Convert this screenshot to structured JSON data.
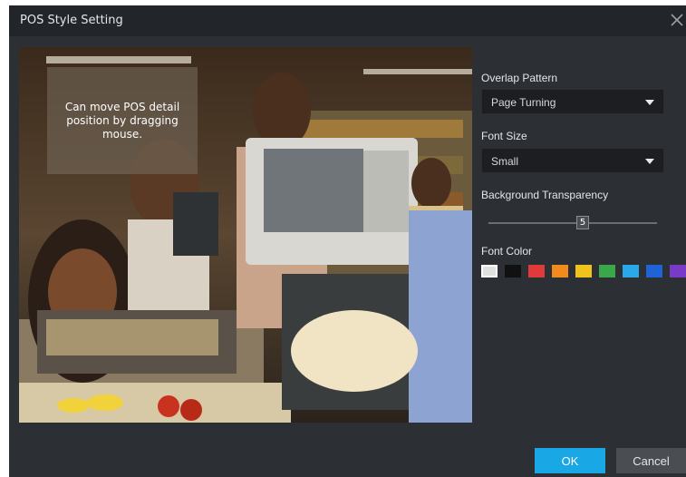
{
  "dialog": {
    "title": "POS Style Setting",
    "close_icon": "close-icon"
  },
  "preview": {
    "overlay_text": "Can move POS detail\nposition by dragging\nmouse."
  },
  "settings": {
    "overlap_pattern": {
      "label": "Overlap Pattern",
      "value": "Page Turning"
    },
    "font_size": {
      "label": "Font Size",
      "value": "Small"
    },
    "background_transparency": {
      "label": "Background Transparency",
      "value": "5"
    },
    "font_color": {
      "label": "Font Color",
      "swatches": [
        {
          "name": "white",
          "color": "#e0e0e0",
          "selected": true
        },
        {
          "name": "black",
          "color": "#111111"
        },
        {
          "name": "red",
          "color": "#e03a3a"
        },
        {
          "name": "orange",
          "color": "#f28a1c"
        },
        {
          "name": "yellow",
          "color": "#f2c21c"
        },
        {
          "name": "green",
          "color": "#3aa84a"
        },
        {
          "name": "light-blue",
          "color": "#2aa9e8"
        },
        {
          "name": "blue",
          "color": "#1f64d6"
        },
        {
          "name": "purple",
          "color": "#7a3ac8"
        }
      ]
    }
  },
  "buttons": {
    "ok": "OK",
    "cancel": "Cancel"
  },
  "colors": {
    "accent": "#1aa7e6",
    "dialog_bg": "#2c2f34",
    "titlebar_bg": "#222529"
  }
}
